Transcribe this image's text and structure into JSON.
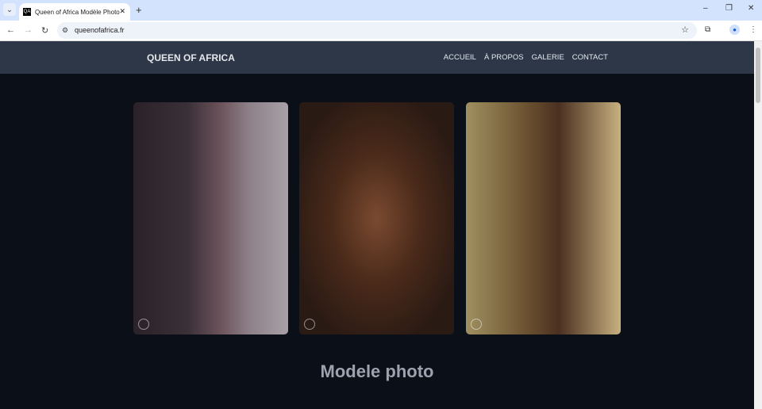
{
  "browser": {
    "tab_title": "Queen of Africa Modèle Photo",
    "favicon_text": "QA",
    "url": "queenofafrica.fr"
  },
  "site": {
    "brand": "QUEEN OF AFRICA",
    "nav": [
      "ACCUEIL",
      "À PROPOS",
      "GALERIE",
      "CONTACT"
    ],
    "heading": "Modele photo"
  },
  "colors": {
    "navbar": "#2d3748",
    "background": "#0b0f17"
  }
}
